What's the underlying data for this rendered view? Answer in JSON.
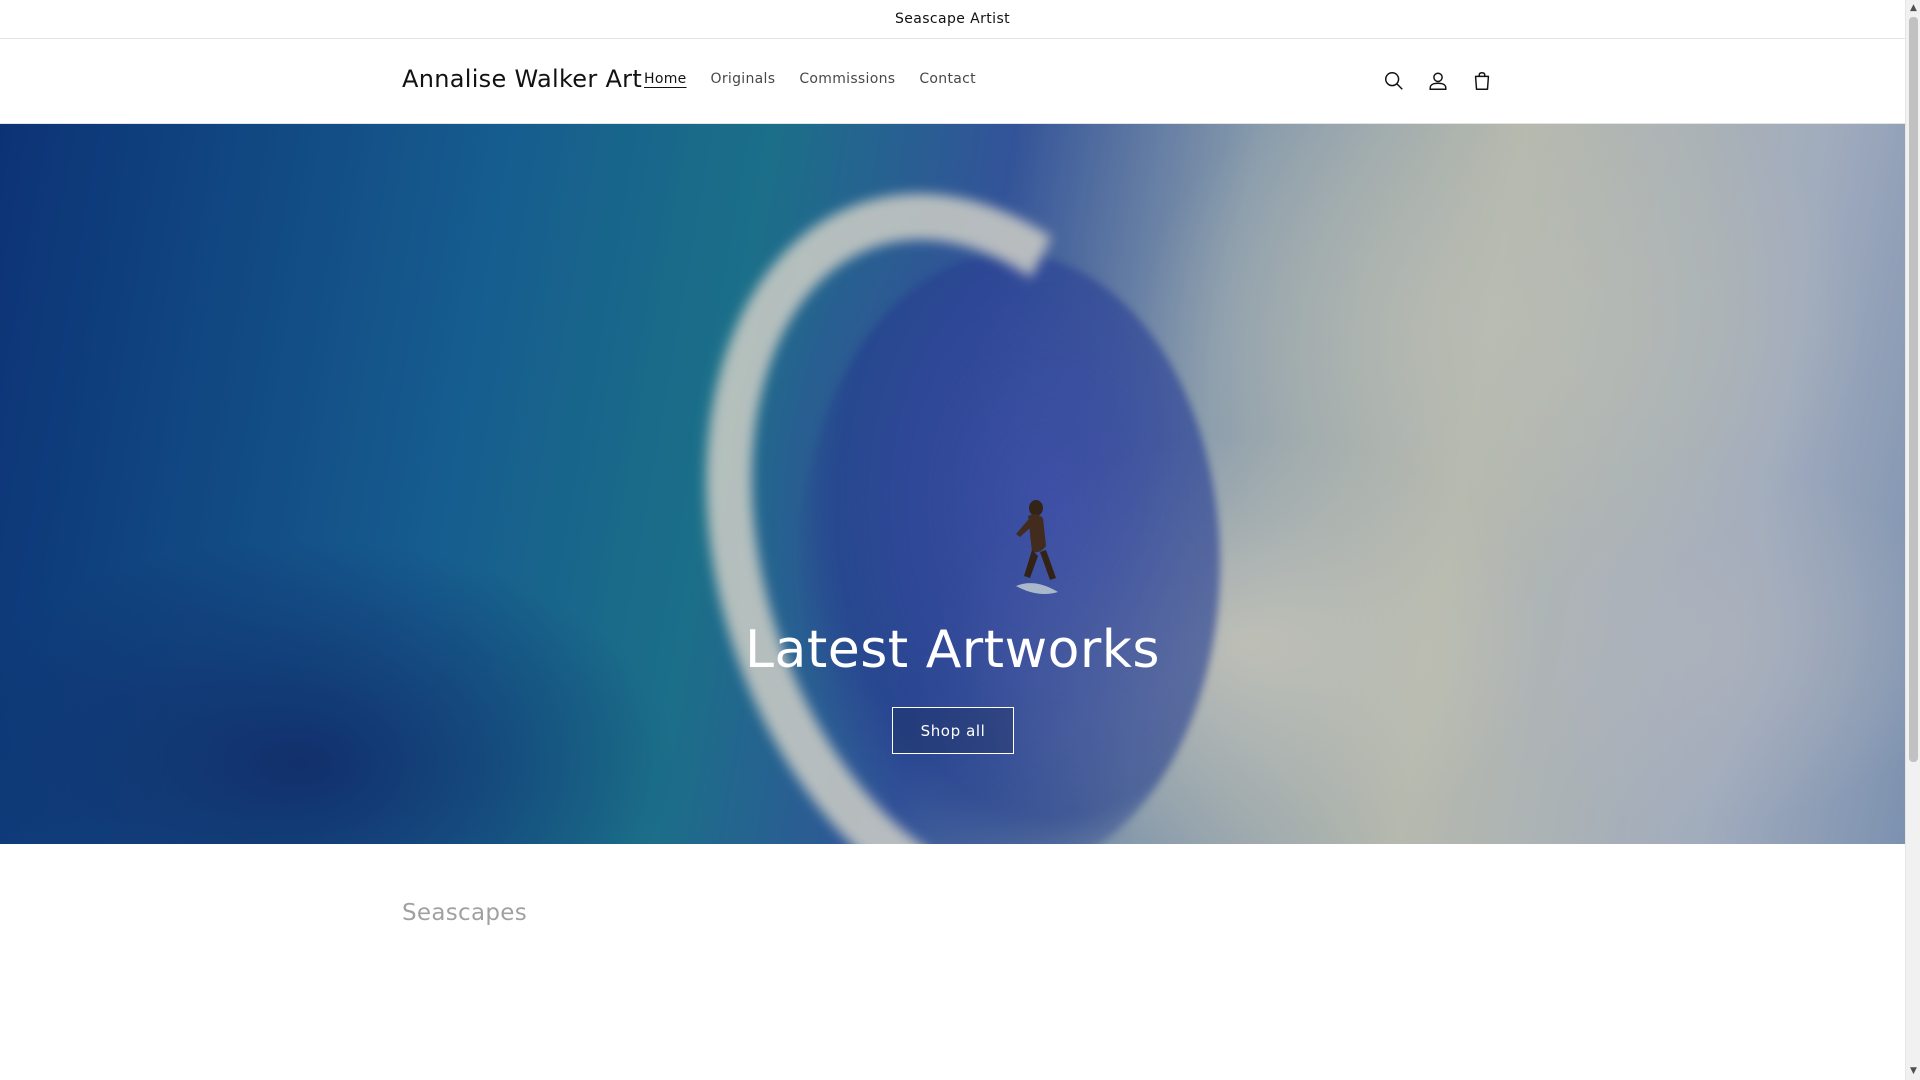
{
  "announcement": {
    "text": "Seascape Artist"
  },
  "header": {
    "logo": "Annalise Walker Art",
    "nav": [
      {
        "label": "Home",
        "active": true
      },
      {
        "label": "Originals",
        "active": false
      },
      {
        "label": "Commissions",
        "active": false
      },
      {
        "label": "Contact",
        "active": false
      }
    ],
    "icons": [
      "search-icon",
      "account-icon",
      "cart-icon"
    ]
  },
  "hero": {
    "title": "Latest Artworks",
    "button_label": "Shop all"
  },
  "collection": {
    "title": "Seascapes"
  },
  "colors": {
    "text": "#121212",
    "border": "#e4e4e4",
    "hero_text": "#ffffff"
  }
}
